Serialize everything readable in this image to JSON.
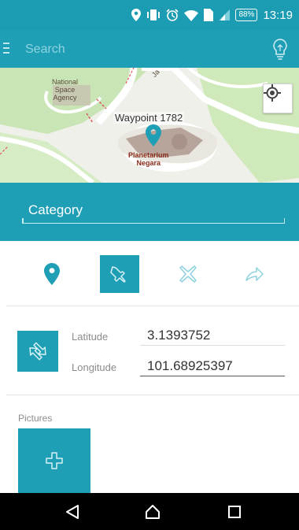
{
  "colors": {
    "primary": "#1f9fb5",
    "status_bar": "#1b9cb2",
    "pin": "#1f9fb5",
    "nav_bar": "#000000"
  },
  "status_bar": {
    "battery": "88%",
    "time": "13:19",
    "icons": [
      "location-icon",
      "vibrate-icon",
      "alarm-icon",
      "wifi-icon",
      "sim-icon",
      "signal-icon"
    ]
  },
  "app_bar": {
    "search_placeholder": "Search",
    "menu_icon": "menu-icon",
    "action_icon": "lightbulb-icon"
  },
  "map": {
    "labels": {
      "agency": "National\nSpace\nAgency",
      "planetarium": "Planetarium\nNegara",
      "road": "Ja"
    },
    "waypoint_label": "Waypoint 1782",
    "locate_icon": "gps-crosshair-icon"
  },
  "category": {
    "placeholder": "Category"
  },
  "mode_tabs": [
    {
      "icon": "pin-icon",
      "active": false
    },
    {
      "icon": "pushpin-icon",
      "active": true
    },
    {
      "icon": "cross-icon",
      "active": false
    },
    {
      "icon": "share-arrow-icon",
      "active": false
    }
  ],
  "coordinates": {
    "latitude_label": "Latitude",
    "latitude_value": "3.1393752",
    "longitude_label": "Longitude",
    "longitude_value": "101.68925397",
    "convert_icon": "swap-icon"
  },
  "pictures": {
    "label": "Pictures",
    "add_icon": "plus-icon"
  },
  "nav": {
    "back_icon": "back-icon",
    "home_icon": "home-icon",
    "recents_icon": "recents-icon"
  }
}
